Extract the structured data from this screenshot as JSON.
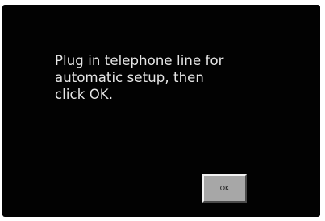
{
  "dialog": {
    "message": "Plug in telephone line for\nautomatic setup, then\nclick OK.",
    "ok_label": "OK"
  },
  "colors": {
    "screen_background": "#020202",
    "message_text": "#e6e6e6",
    "button_face": "#a7a7a7",
    "page_background": "#ffffff"
  }
}
